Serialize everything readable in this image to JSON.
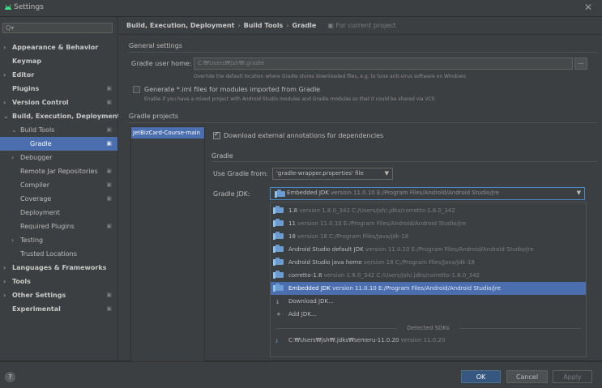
{
  "window": {
    "title": "Settings"
  },
  "search": {
    "placeholder": ""
  },
  "tree": [
    {
      "label": "Appearance & Behavior",
      "bold": true,
      "chevron": "›",
      "level": 0
    },
    {
      "label": "Keymap",
      "bold": true,
      "chevron": "",
      "level": 0
    },
    {
      "label": "Editor",
      "bold": true,
      "chevron": "›",
      "level": 0
    },
    {
      "label": "Plugins",
      "bold": true,
      "chevron": "",
      "level": 0,
      "proj": true
    },
    {
      "label": "Version Control",
      "bold": true,
      "chevron": "›",
      "level": 0,
      "proj": true
    },
    {
      "label": "Build, Execution, Deployment",
      "bold": true,
      "chevron": "⌄",
      "level": 0
    },
    {
      "label": "Build Tools",
      "bold": false,
      "chevron": "⌄",
      "level": 1,
      "proj": true
    },
    {
      "label": "Gradle",
      "bold": false,
      "chevron": "",
      "level": 2,
      "proj": true,
      "selected": true
    },
    {
      "label": "Debugger",
      "bold": false,
      "chevron": "›",
      "level": 1
    },
    {
      "label": "Remote Jar Repositories",
      "bold": false,
      "chevron": "",
      "level": 1,
      "proj": true
    },
    {
      "label": "Compiler",
      "bold": false,
      "chevron": "",
      "level": 1,
      "proj": true
    },
    {
      "label": "Coverage",
      "bold": false,
      "chevron": "",
      "level": 1,
      "proj": true
    },
    {
      "label": "Deployment",
      "bold": false,
      "chevron": "",
      "level": 1
    },
    {
      "label": "Required Plugins",
      "bold": false,
      "chevron": "",
      "level": 1,
      "proj": true
    },
    {
      "label": "Testing",
      "bold": false,
      "chevron": "›",
      "level": 1
    },
    {
      "label": "Trusted Locations",
      "bold": false,
      "chevron": "",
      "level": 1
    },
    {
      "label": "Languages & Frameworks",
      "bold": true,
      "chevron": "›",
      "level": 0
    },
    {
      "label": "Tools",
      "bold": true,
      "chevron": "›",
      "level": 0
    },
    {
      "label": "Other Settings",
      "bold": true,
      "chevron": "›",
      "level": 0,
      "proj": true
    },
    {
      "label": "Experimental",
      "bold": true,
      "chevron": "",
      "level": 0,
      "proj": true
    }
  ],
  "breadcrumb": {
    "part1": "Build, Execution, Deployment",
    "part2": "Build Tools",
    "part3": "Gradle",
    "scope": "For current project"
  },
  "general": {
    "title": "General settings",
    "user_home_label": "Gradle user home:",
    "user_home_value": "C:₩Users₩jsh₩.gradle",
    "browse": "...",
    "user_home_hint": "Override the default location where Gradle stores downloaded files, e.g. to tune anti-virus software on Windows",
    "iml_label": "Generate *.iml files for modules imported from Gradle",
    "iml_hint": "Enable if you have a mixed project with Android Studio modules and Gradle modules so that it could be shared via VCS"
  },
  "projects": {
    "title": "Gradle projects",
    "items": [
      "JetBizCard-Course-main"
    ],
    "annotations_label": "Download external annotations for dependencies",
    "gradle_title": "Gradle",
    "use_from_label": "Use Gradle from:",
    "use_from_value": "'gradle-wrapper.properties' file",
    "jdk_label": "Gradle JDK:",
    "jdk_name": "Embedded JDK",
    "jdk_detail": "version 11.0.10 E:/Program Files/Android/Android Studio/jre"
  },
  "jdk_options": [
    {
      "name": "1.8",
      "detail": "version 1.8.0_342 C:/Users/jsh/.jdks/corretto-1.8.0_342",
      "icon": "jdk-folder-icon"
    },
    {
      "name": "11",
      "detail": "version 11.0.10 E:/Program Files/Android/Android Studio/jre",
      "icon": "jdk-folder-icon"
    },
    {
      "name": "18",
      "detail": "version 18 C:/Program Files/Java/jdk-18",
      "icon": "jdk-folder-icon"
    },
    {
      "name": "Android Studio default JDK",
      "detail": "version 11.0.10 E:/Program Files/Android/Android Studio/jre",
      "icon": "jdk-folder-icon"
    },
    {
      "name": "Android Studio java home",
      "detail": "version 18 C:/Program Files/Java/jdk-18",
      "icon": "jdk-folder-icon"
    },
    {
      "name": "corretto-1.8",
      "detail": "version 1.8.0_342 C:/Users/jsh/.jdks/corretto-1.8.0_342",
      "icon": "jdk-folder-icon"
    },
    {
      "name": "Embedded JDK",
      "detail": "version 11.0.10 E:/Program Files/Android/Android Studio/jre",
      "icon": "jdk-folder-icon",
      "selected": true
    }
  ],
  "jdk_actions": [
    {
      "label": "Download JDK...",
      "icon": "download-icon",
      "glyph": "⤓"
    },
    {
      "label": "Add JDK...",
      "icon": "add-icon",
      "glyph": "+"
    }
  ],
  "detected": {
    "title": "Detected SDKs",
    "name": "C:₩Users₩jsh₩.jdks₩semeru-11.0.20",
    "detail": "version 11.0.20"
  },
  "buttons": {
    "help": "?",
    "ok": "OK",
    "cancel": "Cancel",
    "apply": "Apply"
  },
  "colors": {
    "accent": "#4b6eaf",
    "ok": "#365880",
    "bg": "#3c3f41"
  }
}
